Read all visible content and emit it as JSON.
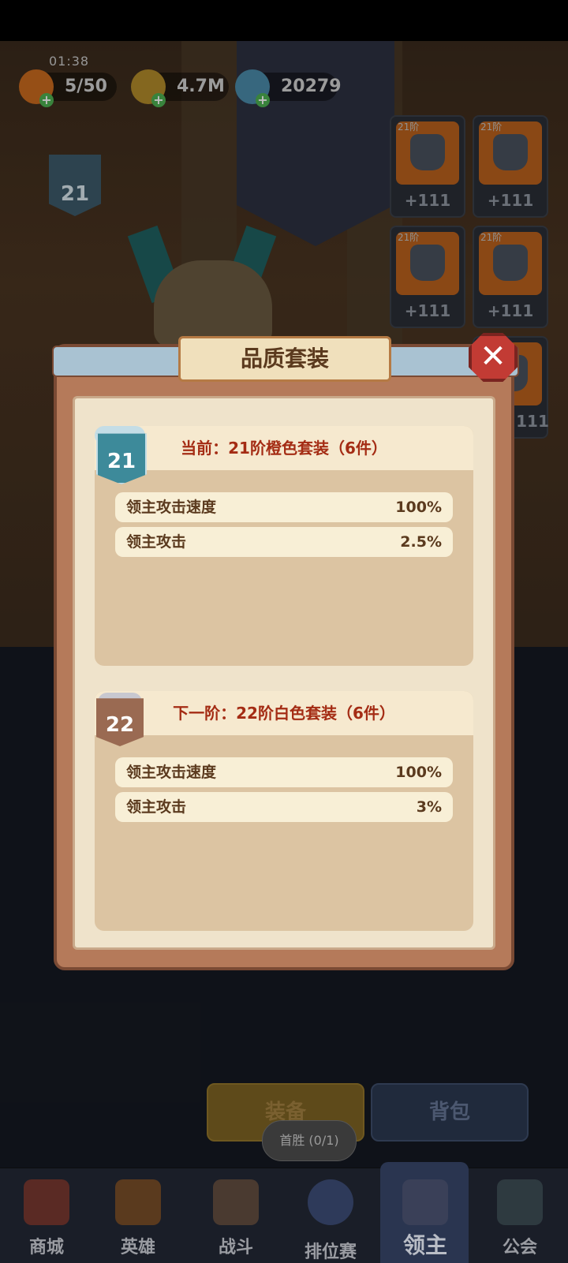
{
  "hud": {
    "clock": "01:38",
    "energy": "5/50",
    "gold": "4.7M",
    "gems": "20279",
    "level_badge": "21"
  },
  "equipment_slots": [
    {
      "tier": "21阶",
      "bonus": "+111"
    },
    {
      "tier": "21阶",
      "bonus": "+111"
    },
    {
      "tier": "21阶",
      "bonus": "+111"
    },
    {
      "tier": "21阶",
      "bonus": "+111"
    },
    {
      "tier": "",
      "bonus": "111"
    }
  ],
  "modal": {
    "title": "品质套装",
    "close_icon": "close-icon",
    "current": {
      "badge": "21",
      "heading": "当前：21阶橙色套装（6件）",
      "stats": [
        {
          "name": "领主攻击速度",
          "value": "100%"
        },
        {
          "name": "领主攻击",
          "value": "2.5%"
        }
      ]
    },
    "next": {
      "badge": "22",
      "heading": "下一阶：22阶白色套装（6件）",
      "stats": [
        {
          "name": "领主攻击速度",
          "value": "100%"
        },
        {
          "name": "领主攻击",
          "value": "3%"
        }
      ]
    }
  },
  "buttons": {
    "equip": "装备",
    "bag": "背包",
    "first_win_tip": "首胜 (0/1)"
  },
  "nav": [
    {
      "label": "商城",
      "icon": "shop-icon"
    },
    {
      "label": "英雄",
      "icon": "hero-card-icon"
    },
    {
      "label": "战斗",
      "icon": "crossed-swords-icon"
    },
    {
      "label": "排位赛",
      "icon": "ranking-shield-icon"
    },
    {
      "label": "领主",
      "icon": "lord-banner-icon"
    },
    {
      "label": "公会",
      "icon": "guild-castle-icon"
    }
  ],
  "colors": {
    "modal_frame": "#b57a5a",
    "heading_red": "#a42c14",
    "close_red": "#c23b34"
  }
}
